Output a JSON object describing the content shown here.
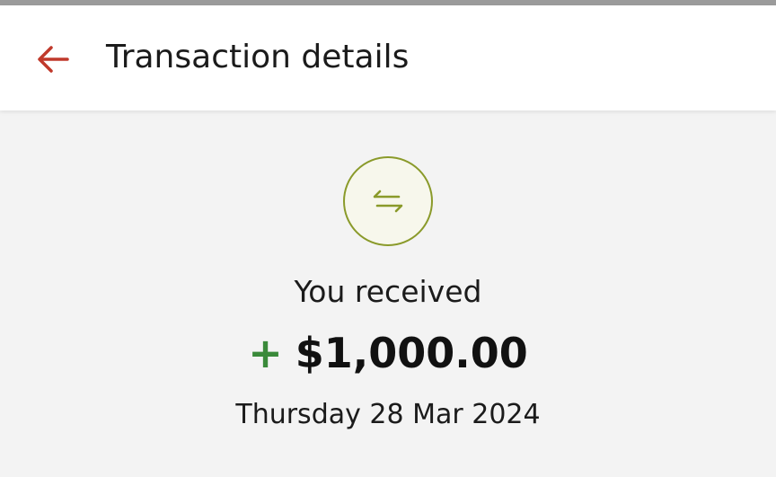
{
  "header": {
    "title": "Transaction details",
    "back_icon": "arrow-left-icon",
    "accent_color": "#c0392b"
  },
  "transaction": {
    "icon": "transfer-arrows-icon",
    "icon_color": "#8a9a2a",
    "label": "You received",
    "sign": "+",
    "sign_color": "#3a8a3a",
    "amount": "$1,000.00",
    "date": "Thursday 28 Mar 2024"
  }
}
